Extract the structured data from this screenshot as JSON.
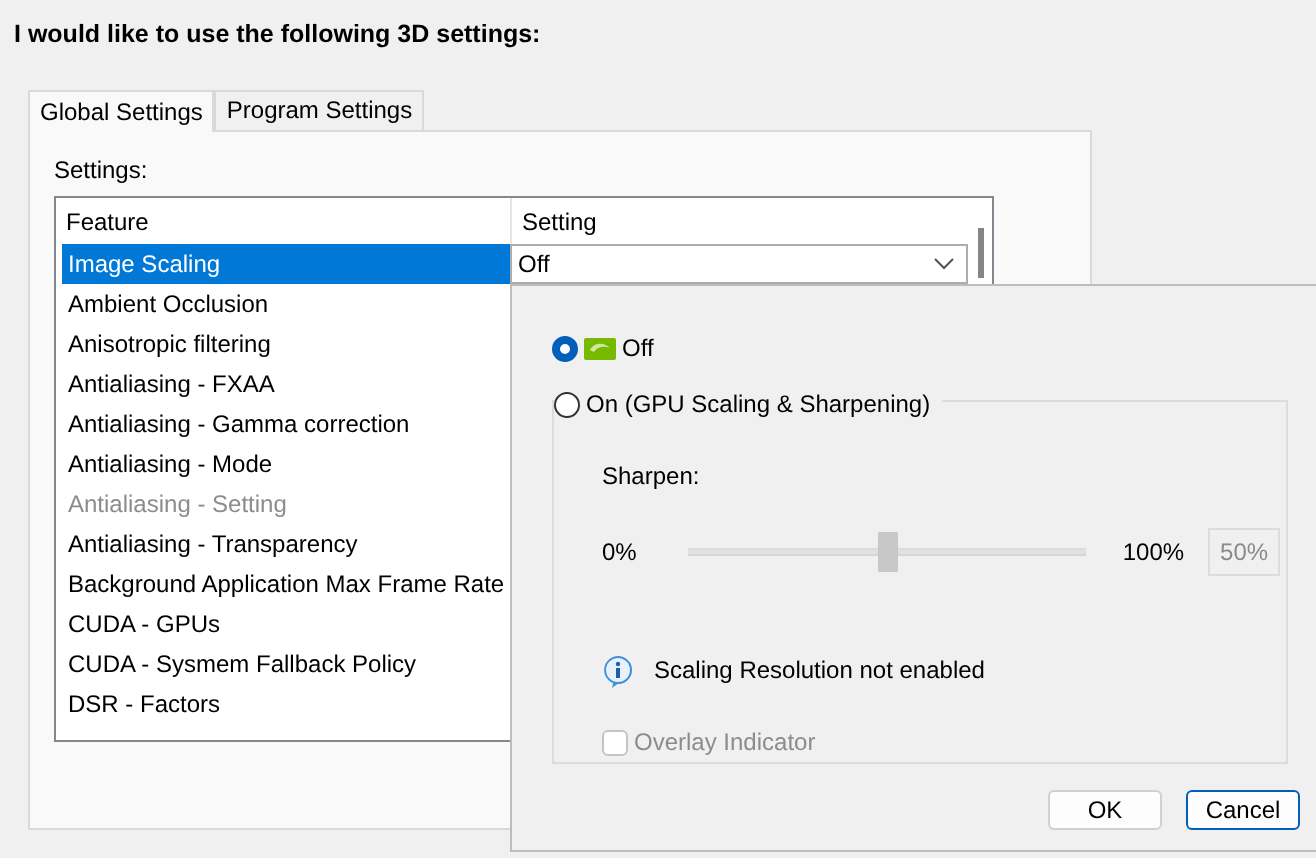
{
  "heading": "I would like to use the following 3D settings:",
  "tabs": [
    {
      "label": "Global Settings",
      "selected": true
    },
    {
      "label": "Program Settings",
      "selected": false
    }
  ],
  "settings_label": "Settings:",
  "table": {
    "columns": [
      "Feature",
      "Setting"
    ],
    "rows": [
      {
        "feature": "Image Scaling",
        "setting": "Off",
        "selected": true,
        "disabled": false
      },
      {
        "feature": "Ambient Occlusion",
        "selected": false,
        "disabled": false
      },
      {
        "feature": "Anisotropic filtering",
        "selected": false,
        "disabled": false
      },
      {
        "feature": "Antialiasing - FXAA",
        "selected": false,
        "disabled": false
      },
      {
        "feature": "Antialiasing - Gamma correction",
        "selected": false,
        "disabled": false
      },
      {
        "feature": "Antialiasing - Mode",
        "selected": false,
        "disabled": false
      },
      {
        "feature": "Antialiasing - Setting",
        "selected": false,
        "disabled": true
      },
      {
        "feature": "Antialiasing - Transparency",
        "selected": false,
        "disabled": false
      },
      {
        "feature": "Background Application Max Frame Rate",
        "selected": false,
        "disabled": false
      },
      {
        "feature": "CUDA - GPUs",
        "selected": false,
        "disabled": false
      },
      {
        "feature": "CUDA - Sysmem Fallback Policy",
        "selected": false,
        "disabled": false
      },
      {
        "feature": "DSR - Factors",
        "selected": false,
        "disabled": false
      }
    ]
  },
  "popup": {
    "options": [
      {
        "label": "Off",
        "selected": true
      },
      {
        "label": "On (GPU Scaling & Sharpening)",
        "selected": false
      }
    ],
    "sharpen_label": "Sharpen:",
    "slider": {
      "min_label": "0%",
      "max_label": "100%",
      "level": 0.5,
      "value": "50%",
      "disabled": true
    },
    "info": "Scaling Resolution not enabled",
    "overlay": {
      "label": "Overlay Indicator",
      "checked": false,
      "disabled": true
    },
    "buttons": [
      {
        "label": "OK",
        "focused": false
      },
      {
        "label": "Cancel",
        "focused": true
      }
    ]
  }
}
